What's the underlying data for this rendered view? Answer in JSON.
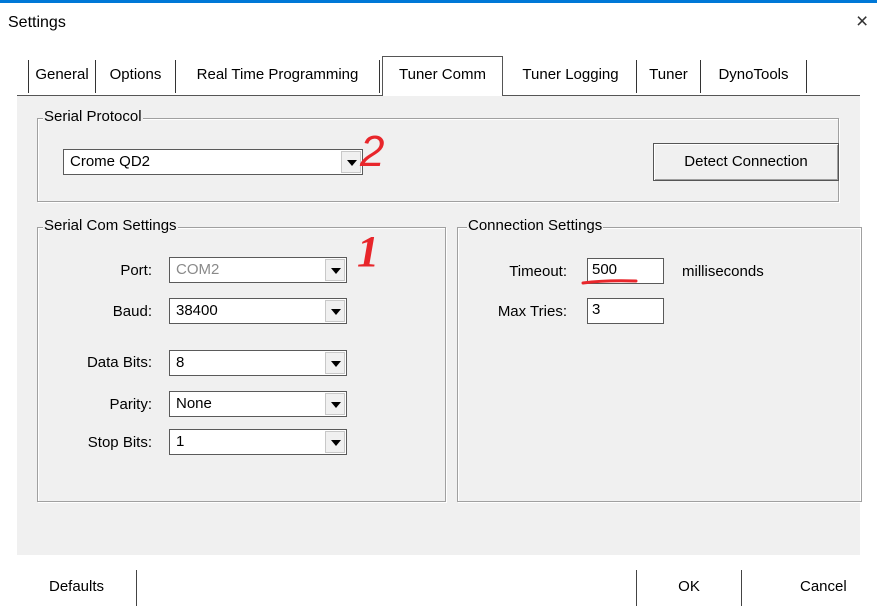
{
  "window": {
    "title": "Settings",
    "close_label": "×"
  },
  "tabs": [
    "General",
    "Options",
    "Real Time Programming",
    "Tuner Comm",
    "Tuner Logging",
    "Tuner",
    "DynoTools"
  ],
  "serial_protocol": {
    "legend": "Serial Protocol",
    "selected": "Crome QD2",
    "detect_button": "Detect Connection"
  },
  "serial_com": {
    "legend": "Serial Com Settings",
    "port_label": "Port:",
    "port_value": "COM2",
    "baud_label": "Baud:",
    "baud_value": "38400",
    "data_bits_label": "Data Bits:",
    "data_bits_value": "8",
    "parity_label": "Parity:",
    "parity_value": "None",
    "stop_bits_label": "Stop Bits:",
    "stop_bits_value": "1"
  },
  "connection": {
    "legend": "Connection Settings",
    "timeout_label": "Timeout:",
    "timeout_value": "500",
    "timeout_unit": "milliseconds",
    "max_tries_label": "Max Tries:",
    "max_tries_value": "3"
  },
  "annotations": {
    "mark_1": "1",
    "mark_2": "2",
    "color": "#e8262b"
  },
  "footer": {
    "defaults": "Defaults",
    "ok": "OK",
    "cancel": "Cancel"
  }
}
